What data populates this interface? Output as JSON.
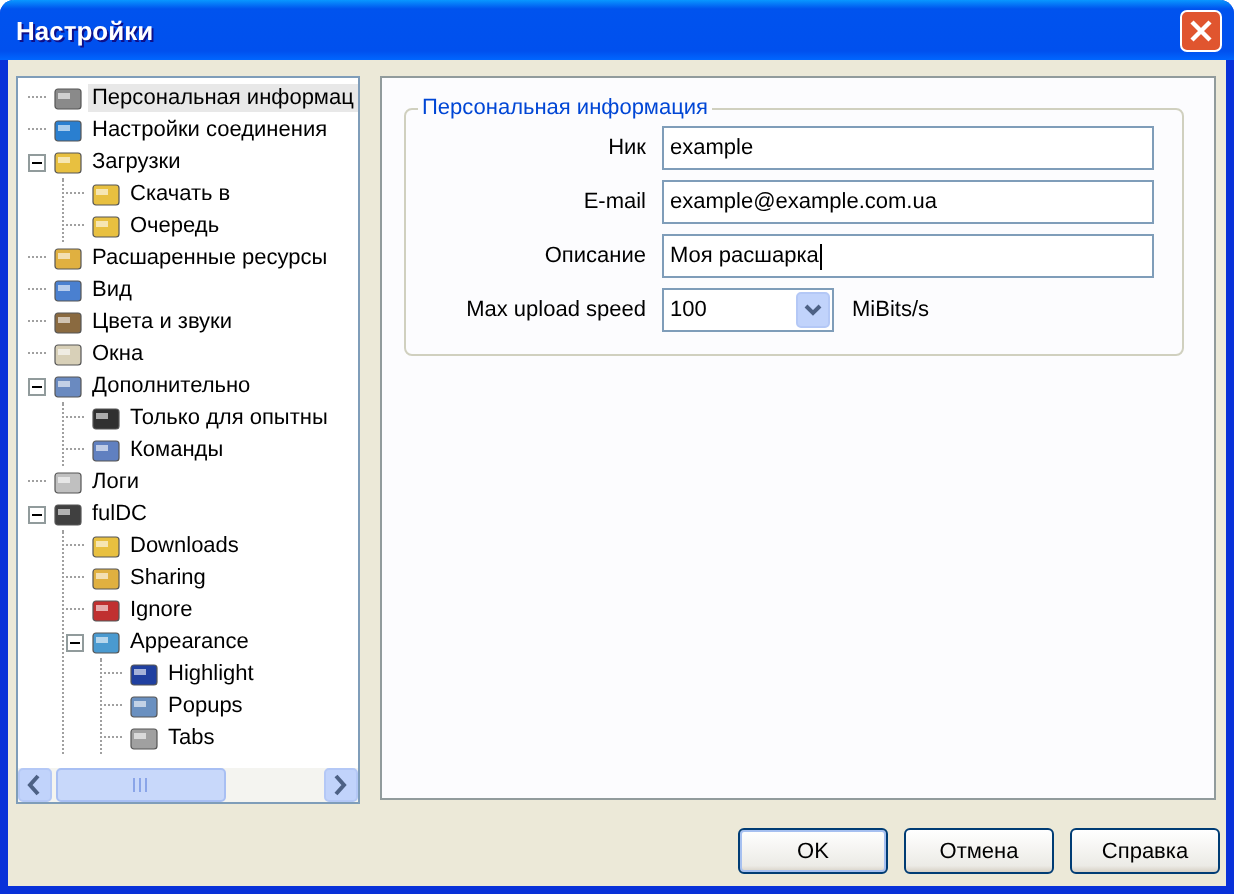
{
  "window": {
    "title": "Настройки"
  },
  "tree": [
    {
      "label": "Персональная информац",
      "selected": true
    },
    {
      "label": "Настройки соединения",
      "selected": false
    },
    {
      "label": "Загрузки",
      "selected": false,
      "expanded": true,
      "children": [
        {
          "label": "Скачать в",
          "selected": false
        },
        {
          "label": "Очередь",
          "selected": false
        }
      ]
    },
    {
      "label": "Расшаренные ресурсы",
      "selected": false
    },
    {
      "label": "Вид",
      "selected": false
    },
    {
      "label": "Цвета и звуки",
      "selected": false
    },
    {
      "label": "Окна",
      "selected": false
    },
    {
      "label": "Дополнительно",
      "selected": false,
      "expanded": true,
      "children": [
        {
          "label": "Только для опытны",
          "selected": false
        },
        {
          "label": "Команды",
          "selected": false
        }
      ]
    },
    {
      "label": "Логи",
      "selected": false
    },
    {
      "label": "fulDC",
      "selected": false,
      "expanded": true,
      "children": [
        {
          "label": "Downloads",
          "selected": false
        },
        {
          "label": "Sharing",
          "selected": false
        },
        {
          "label": "Ignore",
          "selected": false
        },
        {
          "label": "Appearance",
          "selected": false,
          "expanded": true,
          "children": [
            {
              "label": "Highlight",
              "selected": false
            },
            {
              "label": "Popups",
              "selected": false
            },
            {
              "label": "Tabs",
              "selected": false
            }
          ]
        }
      ]
    }
  ],
  "group": {
    "title": "Персональная информация",
    "fields": [
      {
        "kind": "text",
        "label": "Ник",
        "value": "example"
      },
      {
        "kind": "text",
        "label": "E-mail",
        "value": "example@example.com.ua"
      },
      {
        "kind": "text",
        "label": "Описание",
        "value": "Моя расшарка"
      },
      {
        "kind": "combo",
        "label": "Max upload speed",
        "value": "100",
        "unit": "MiBits/s"
      }
    ]
  },
  "buttons": [
    "OK",
    "Отмена",
    "Справка"
  ]
}
